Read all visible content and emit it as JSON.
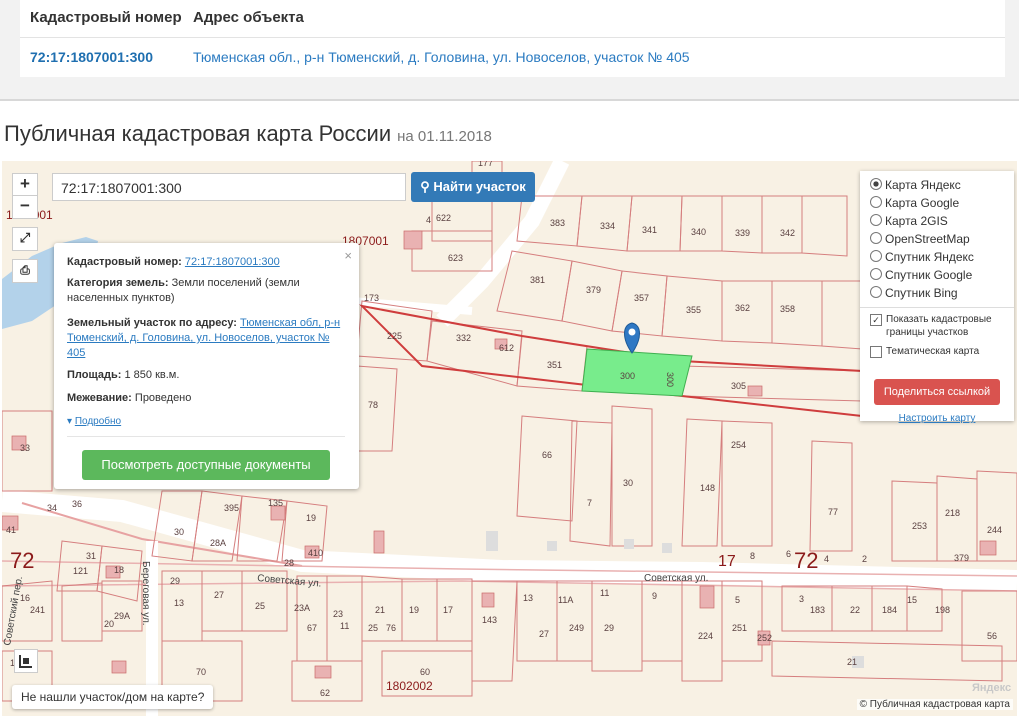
{
  "table": {
    "col_cadnum": "Кадастровый номер",
    "col_address": "Адрес объекта",
    "row_cadnum": "72:17:1807001:300",
    "row_address": "Тюменская обл., р-н Тюменский, д. Головина, ул. Новоселов, участок № 405"
  },
  "page": {
    "title": "Публичная кадастровая карта России",
    "date": "на 01.11.2018"
  },
  "search": {
    "value": "72:17:1807001:300",
    "button": "Найти участок"
  },
  "zoom": {
    "plus": "+",
    "minus": "−"
  },
  "popup": {
    "cad_label": "Кадастровый номер:",
    "cad_value": "72:17:1807001:300",
    "cat_label": "Категория земель:",
    "cat_value": "Земли поселений (земли населенных пунктов)",
    "addr_label": "Земельный участок по адресу:",
    "addr_value": "Тюменская обл, р-н Тюменский, д. Головина, ул. Новоселов, участок № 405",
    "area_label": "Площадь:",
    "area_value": "1 850 кв.м.",
    "survey_label": "Межевание:",
    "survey_value": "Проведено",
    "more_link": "Подробно",
    "docs_button": "Посмотреть доступные документы",
    "close": "×"
  },
  "layers": {
    "options": [
      "Карта Яндекс",
      "Карта Google",
      "Карта 2GIS",
      "OpenStreetMap",
      "Спутник Яндекс",
      "Спутник Google",
      "Спутник Bing"
    ],
    "selected": "Карта Яндекс",
    "show_cadastral": "Показать кадастровые границы участков",
    "show_cadastral_checked": true,
    "thematic": "Тематическая карта",
    "thematic_checked": false,
    "share_button": "Поделиться ссылкой",
    "configure_link": "Настроить карту"
  },
  "map": {
    "not_found": "Не нашли участок/дом на карте?",
    "copyright": "© Публичная кадастровая карта",
    "yandex": "Яндекс",
    "region_code": "72",
    "quarter_1": "1807001",
    "quarter_2": "1802002",
    "quarter_3": "1806001",
    "street_1": "Советская ул.",
    "street_2": "Советская ул.",
    "street_3": "Советский пер.",
    "street_4": "Береговая ул.",
    "selected_parcel": "300",
    "parcels": [
      "177",
      "4",
      "622",
      "623",
      "383",
      "334",
      "341",
      "340",
      "339",
      "342",
      "381",
      "379",
      "357",
      "355",
      "362",
      "358",
      "173",
      "225",
      "332",
      "612",
      "351",
      "305",
      "78",
      "66",
      "30",
      "7",
      "254",
      "148",
      "77",
      "33",
      "34",
      "36",
      "395",
      "135",
      "19",
      "30",
      "28А",
      "410",
      "28",
      "31",
      "121",
      "18",
      "29",
      "13",
      "27",
      "25",
      "23А",
      "23",
      "21",
      "19",
      "17",
      "143",
      "13",
      "11А",
      "11",
      "9",
      "5",
      "3",
      "183",
      "22",
      "184",
      "15",
      "198",
      "253",
      "218",
      "244",
      "379",
      "41",
      "16",
      "29А",
      "20",
      "67",
      "11",
      "25",
      "76",
      "27",
      "249",
      "29",
      "224",
      "251",
      "252",
      "56",
      "21",
      "70",
      "62",
      "60",
      "241",
      "17",
      "8",
      "6",
      "4",
      "2",
      "72"
    ]
  }
}
